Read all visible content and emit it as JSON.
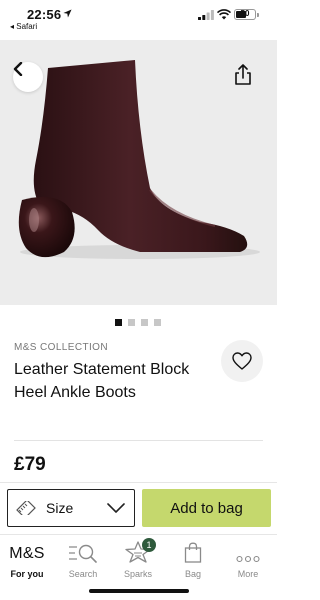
{
  "status_bar": {
    "time": "22:56",
    "back_app": "◂ Safari",
    "battery_level": "50"
  },
  "gallery": {
    "image_count": 4,
    "active_index": 0
  },
  "product": {
    "brand": "M&S COLLECTION",
    "title": "Leather Statement Block Heel Ankle Boots",
    "price": "£79",
    "color": "#3a1a1e"
  },
  "actions": {
    "size_label": "Size",
    "add_label": "Add to bag",
    "add_color": "#c5d86d"
  },
  "tabs": [
    {
      "label": "For you",
      "icon": "ms-logo-icon",
      "logo_text": "M&S",
      "active": true
    },
    {
      "label": "Search",
      "icon": "search-icon"
    },
    {
      "label": "Sparks",
      "icon": "sparks-star-icon",
      "badge": "1"
    },
    {
      "label": "Bag",
      "icon": "bag-icon"
    },
    {
      "label": "More",
      "icon": "more-dots-icon"
    }
  ]
}
